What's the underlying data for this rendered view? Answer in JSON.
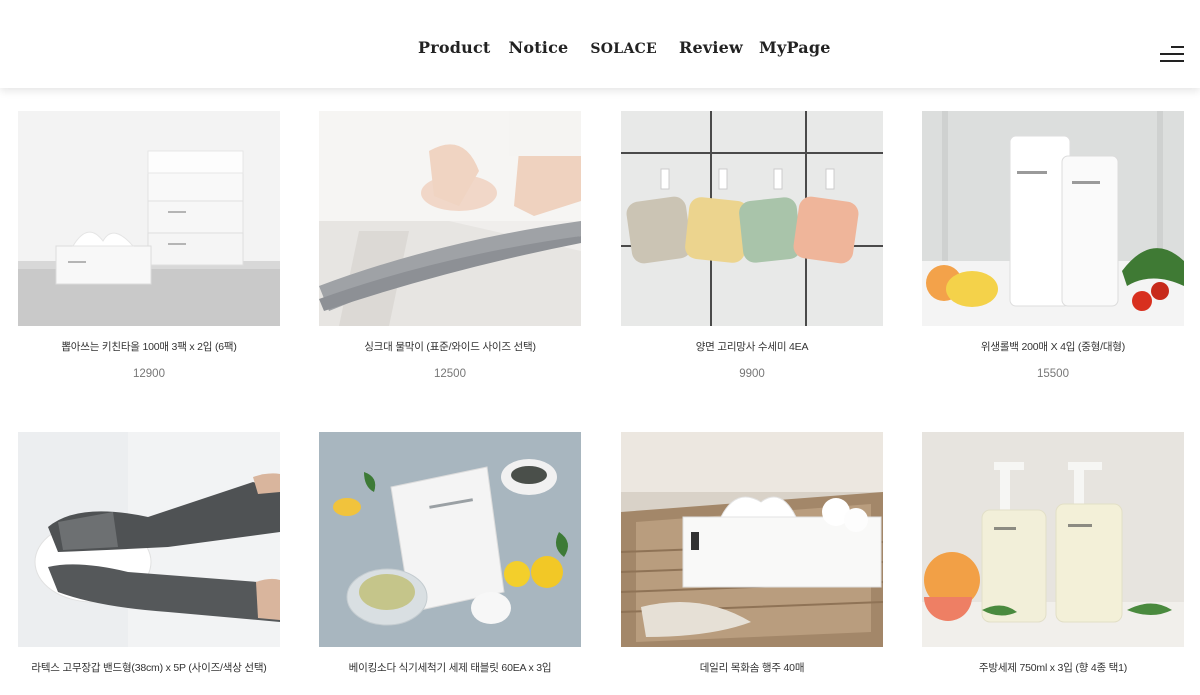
{
  "nav": {
    "items": [
      "Product",
      "Notice",
      "SOLACE",
      "Review",
      "MyPage"
    ],
    "menu_icon": "hamburger-menu-icon"
  },
  "products": [
    {
      "name": "뽑아쓰는 키친타올 100매 3팩 x 2입 (6팩)",
      "price": "12900"
    },
    {
      "name": "싱크대 물막이 (표준/와이드 사이즈 선택)",
      "price": "12500"
    },
    {
      "name": "양면 고리망사 수세미 4EA",
      "price": "9900"
    },
    {
      "name": "위생롤백 200매 X 4입 (중형/대형)",
      "price": "15500"
    },
    {
      "name": "라텍스 고무장갑 밴드형(38cm) x 5P (사이즈/색상 선택)",
      "price": ""
    },
    {
      "name": "베이킹소다 식기세척기 세제 태블릿 60EA x 3입",
      "price": ""
    },
    {
      "name": "데일리 목화솜 행주 40매",
      "price": ""
    },
    {
      "name": "주방세제 750ml x 3입 (향 4종 택1)",
      "price": ""
    }
  ]
}
